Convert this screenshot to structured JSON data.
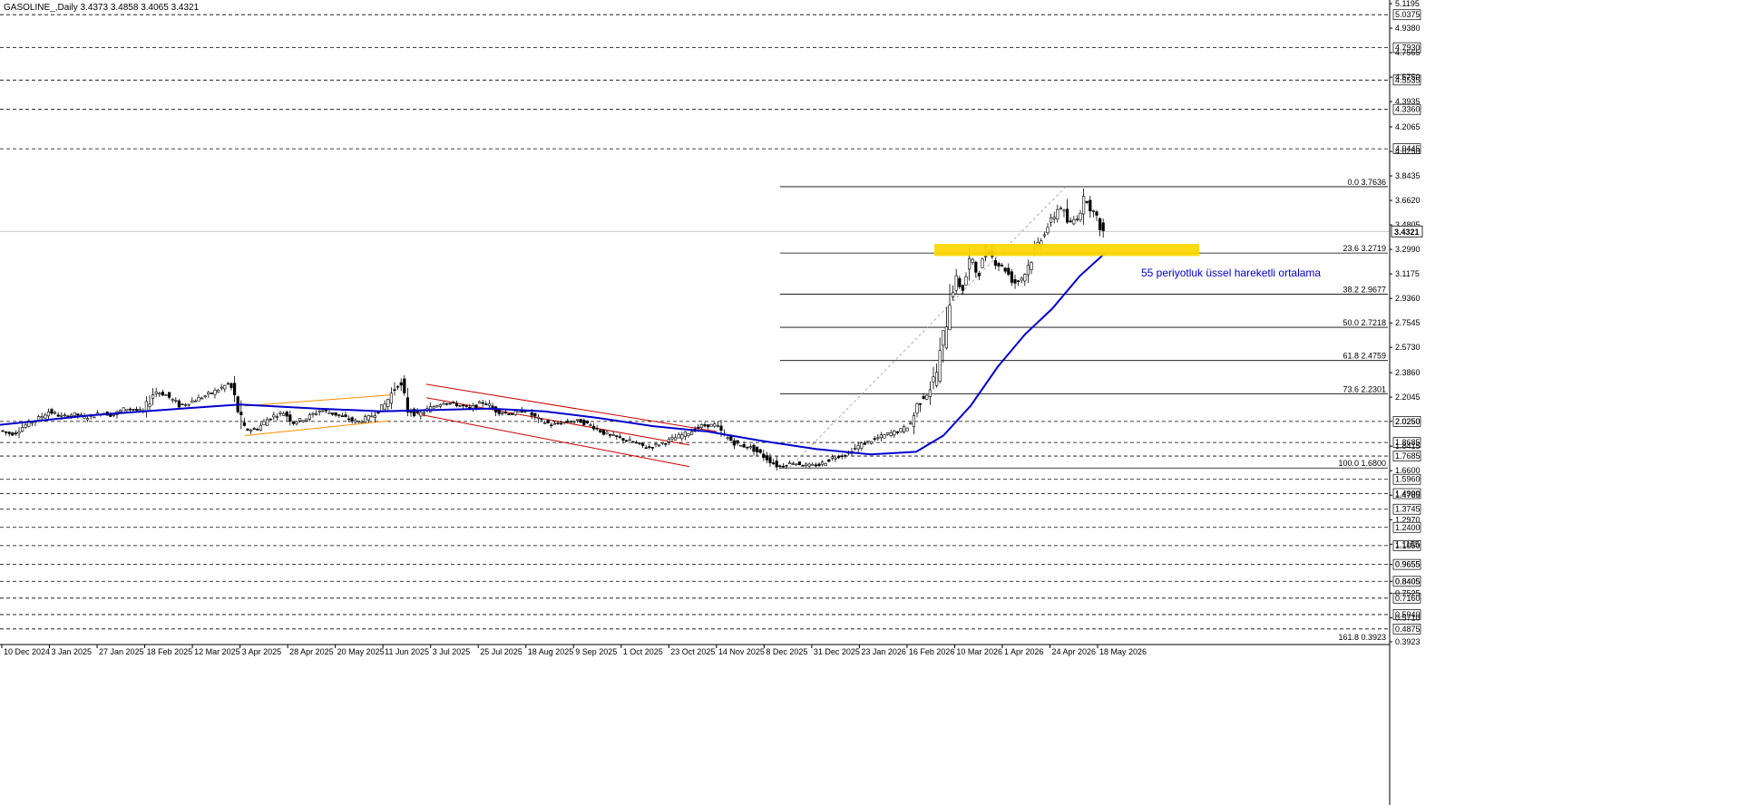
{
  "header": {
    "text": "GASOLINE_,Daily  3.4373 3.4858 3.4065 3.4321"
  },
  "chart_data": {
    "type": "candlestick",
    "symbol": "GASOLINE_",
    "timeframe": "Daily",
    "ylim": [
      0.3923,
      5.1195
    ],
    "price_ticks": [
      "5.1195",
      "4.9380",
      "4.7565",
      "4.5750",
      "4.3935",
      "4.2065",
      "4.0250",
      "3.8435",
      "3.6620",
      "3.4805",
      "3.2990",
      "3.1175",
      "2.9360",
      "2.7545",
      "2.5730",
      "2.3860",
      "2.2045",
      "2.0250",
      "1.8415",
      "1.6600",
      "1.4785",
      "1.2970",
      "1.1155",
      "0.9655",
      "0.8405",
      "0.7525",
      "0.5710",
      "0.3923"
    ],
    "level_lines": [
      "5.0375",
      "4.7930",
      "4.5535",
      "4.3360",
      "4.0445",
      "2.0250",
      "1.8685",
      "1.7685",
      "1.5960",
      "1.4900",
      "1.3745",
      "1.2400",
      "1.1050",
      "0.9655",
      "0.8405",
      "0.7160",
      "0.5940",
      "0.4875"
    ],
    "current_price": "3.4321",
    "date_labels": [
      "10 Dec 2024",
      "3 Jan 2025",
      "27 Jan 2025",
      "18 Feb 2025",
      "12 Mar 2025",
      "3 Apr 2025",
      "28 Apr 2025",
      "20 May 2025",
      "11 Jun 2025",
      "3 Jul 2025",
      "25 Jul 2025",
      "18 Aug 2025",
      "9 Sep 2025",
      "1 Oct 2025",
      "23 Oct 2025",
      "14 Nov 2025",
      "8 Dec 2025",
      "31 Dec 2025",
      "23 Jan 2026",
      "16 Feb 2026",
      "10 Mar 2026",
      "1 Apr 2026",
      "24 Apr 2026",
      "18 May 2026"
    ],
    "fibonacci": {
      "high": 3.7636,
      "low": 1.68,
      "levels": [
        {
          "label": "0.0 3.7636",
          "value": 3.7636
        },
        {
          "label": "23.6 3.2719",
          "value": 3.2719
        },
        {
          "label": "38.2 2.9677",
          "value": 2.9677
        },
        {
          "label": "50.0 2.7218",
          "value": 2.7218
        },
        {
          "label": "61.8 2.4759",
          "value": 2.4759
        },
        {
          "label": "73.6 2.2301",
          "value": 2.2301
        },
        {
          "label": "100.0 1.6800",
          "value": 1.68
        },
        {
          "label": "161.8 0.3923",
          "value": 0.3923
        }
      ]
    },
    "ema_label": "55 periyotluk üssel hareketli ortalama",
    "support_zone": [
      3.25,
      3.34
    ],
    "ohlc_last": {
      "open": 3.4373,
      "high": 3.4858,
      "low": 3.4065,
      "close": 3.4321
    },
    "colors": {
      "ema": "#0000cc",
      "zone": "#ffd700",
      "channel_up": "#ff8c00",
      "channel_down": "#cc0000",
      "candle": "#000000"
    },
    "candle_path": [
      [
        0,
        1.96
      ],
      [
        15,
        1.93
      ],
      [
        30,
        2.0
      ],
      [
        45,
        2.05
      ],
      [
        55,
        2.1
      ],
      [
        70,
        2.06
      ],
      [
        85,
        2.08
      ],
      [
        95,
        2.05
      ],
      [
        105,
        2.07
      ],
      [
        115,
        2.09
      ],
      [
        125,
        2.07
      ],
      [
        140,
        2.12
      ],
      [
        160,
        2.1
      ],
      [
        172,
        2.25
      ],
      [
        185,
        2.22
      ],
      [
        200,
        2.14
      ],
      [
        215,
        2.18
      ],
      [
        230,
        2.22
      ],
      [
        245,
        2.27
      ],
      [
        255,
        2.31
      ],
      [
        262,
        2.16
      ],
      [
        270,
        1.96
      ],
      [
        285,
        1.97
      ],
      [
        300,
        2.06
      ],
      [
        315,
        2.09
      ],
      [
        325,
        2.02
      ],
      [
        340,
        2.05
      ],
      [
        355,
        2.11
      ],
      [
        375,
        2.07
      ],
      [
        395,
        2.02
      ],
      [
        410,
        2.06
      ],
      [
        425,
        2.14
      ],
      [
        435,
        2.25
      ],
      [
        442,
        2.33
      ],
      [
        450,
        2.12
      ],
      [
        462,
        2.07
      ],
      [
        475,
        2.12
      ],
      [
        490,
        2.17
      ],
      [
        505,
        2.15
      ],
      [
        520,
        2.12
      ],
      [
        535,
        2.17
      ],
      [
        550,
        2.1
      ],
      [
        565,
        2.08
      ],
      [
        580,
        2.11
      ],
      [
        595,
        2.04
      ],
      [
        610,
        2.0
      ],
      [
        625,
        2.02
      ],
      [
        640,
        2.03
      ],
      [
        655,
        1.99
      ],
      [
        670,
        1.93
      ],
      [
        685,
        1.9
      ],
      [
        700,
        1.87
      ],
      [
        715,
        1.83
      ],
      [
        730,
        1.86
      ],
      [
        745,
        1.9
      ],
      [
        760,
        1.94
      ],
      [
        775,
        1.99
      ],
      [
        790,
        2.0
      ],
      [
        800,
        1.92
      ],
      [
        815,
        1.85
      ],
      [
        830,
        1.83
      ],
      [
        845,
        1.76
      ],
      [
        860,
        1.69
      ],
      [
        875,
        1.72
      ],
      [
        890,
        1.7
      ],
      [
        905,
        1.7
      ],
      [
        920,
        1.76
      ],
      [
        935,
        1.78
      ],
      [
        950,
        1.85
      ],
      [
        965,
        1.89
      ],
      [
        980,
        1.93
      ],
      [
        995,
        1.96
      ],
      [
        1005,
        2.0
      ],
      [
        1015,
        2.18
      ],
      [
        1025,
        2.24
      ],
      [
        1035,
        2.4
      ],
      [
        1042,
        2.65
      ],
      [
        1048,
        2.92
      ],
      [
        1055,
        3.08
      ],
      [
        1063,
        3.0
      ],
      [
        1072,
        3.25
      ],
      [
        1080,
        3.1
      ],
      [
        1090,
        3.3
      ],
      [
        1100,
        3.2
      ],
      [
        1110,
        3.15
      ],
      [
        1120,
        3.05
      ],
      [
        1130,
        3.1
      ],
      [
        1140,
        3.25
      ],
      [
        1150,
        3.4
      ],
      [
        1160,
        3.5
      ],
      [
        1170,
        3.63
      ],
      [
        1180,
        3.48
      ],
      [
        1190,
        3.55
      ],
      [
        1198,
        3.68
      ],
      [
        1205,
        3.6
      ],
      [
        1212,
        3.5
      ],
      [
        1218,
        3.43
      ]
    ],
    "ema_path": [
      [
        0,
        2.0
      ],
      [
        100,
        2.07
      ],
      [
        200,
        2.12
      ],
      [
        265,
        2.15
      ],
      [
        350,
        2.12
      ],
      [
        420,
        2.1
      ],
      [
        480,
        2.11
      ],
      [
        540,
        2.12
      ],
      [
        600,
        2.1
      ],
      [
        660,
        2.05
      ],
      [
        720,
        1.99
      ],
      [
        780,
        1.95
      ],
      [
        840,
        1.88
      ],
      [
        900,
        1.82
      ],
      [
        960,
        1.78
      ],
      [
        1010,
        1.8
      ],
      [
        1040,
        1.92
      ],
      [
        1070,
        2.14
      ],
      [
        1100,
        2.43
      ],
      [
        1130,
        2.67
      ],
      [
        1160,
        2.86
      ],
      [
        1190,
        3.1
      ],
      [
        1218,
        3.27
      ]
    ]
  }
}
